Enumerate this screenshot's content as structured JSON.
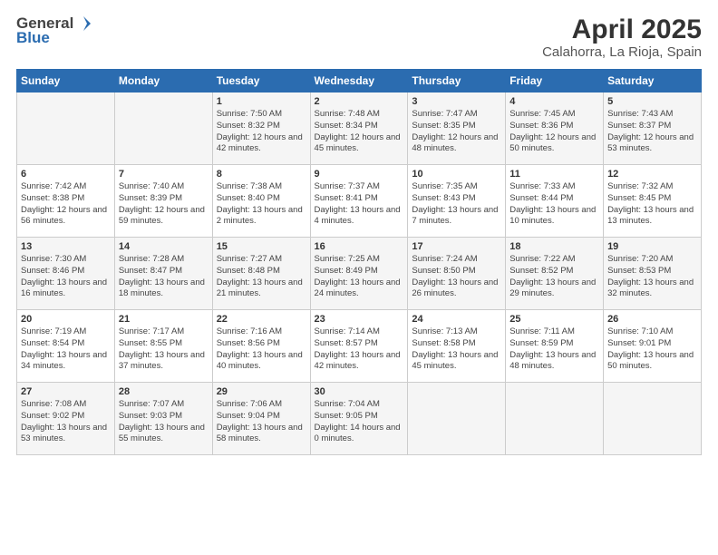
{
  "logo": {
    "general": "General",
    "blue": "Blue"
  },
  "title": "April 2025",
  "subtitle": "Calahorra, La Rioja, Spain",
  "days_of_week": [
    "Sunday",
    "Monday",
    "Tuesday",
    "Wednesday",
    "Thursday",
    "Friday",
    "Saturday"
  ],
  "weeks": [
    [
      {
        "day": "",
        "sunrise": "",
        "sunset": "",
        "daylight": ""
      },
      {
        "day": "",
        "sunrise": "",
        "sunset": "",
        "daylight": ""
      },
      {
        "day": "1",
        "sunrise": "Sunrise: 7:50 AM",
        "sunset": "Sunset: 8:32 PM",
        "daylight": "Daylight: 12 hours and 42 minutes."
      },
      {
        "day": "2",
        "sunrise": "Sunrise: 7:48 AM",
        "sunset": "Sunset: 8:34 PM",
        "daylight": "Daylight: 12 hours and 45 minutes."
      },
      {
        "day": "3",
        "sunrise": "Sunrise: 7:47 AM",
        "sunset": "Sunset: 8:35 PM",
        "daylight": "Daylight: 12 hours and 48 minutes."
      },
      {
        "day": "4",
        "sunrise": "Sunrise: 7:45 AM",
        "sunset": "Sunset: 8:36 PM",
        "daylight": "Daylight: 12 hours and 50 minutes."
      },
      {
        "day": "5",
        "sunrise": "Sunrise: 7:43 AM",
        "sunset": "Sunset: 8:37 PM",
        "daylight": "Daylight: 12 hours and 53 minutes."
      }
    ],
    [
      {
        "day": "6",
        "sunrise": "Sunrise: 7:42 AM",
        "sunset": "Sunset: 8:38 PM",
        "daylight": "Daylight: 12 hours and 56 minutes."
      },
      {
        "day": "7",
        "sunrise": "Sunrise: 7:40 AM",
        "sunset": "Sunset: 8:39 PM",
        "daylight": "Daylight: 12 hours and 59 minutes."
      },
      {
        "day": "8",
        "sunrise": "Sunrise: 7:38 AM",
        "sunset": "Sunset: 8:40 PM",
        "daylight": "Daylight: 13 hours and 2 minutes."
      },
      {
        "day": "9",
        "sunrise": "Sunrise: 7:37 AM",
        "sunset": "Sunset: 8:41 PM",
        "daylight": "Daylight: 13 hours and 4 minutes."
      },
      {
        "day": "10",
        "sunrise": "Sunrise: 7:35 AM",
        "sunset": "Sunset: 8:43 PM",
        "daylight": "Daylight: 13 hours and 7 minutes."
      },
      {
        "day": "11",
        "sunrise": "Sunrise: 7:33 AM",
        "sunset": "Sunset: 8:44 PM",
        "daylight": "Daylight: 13 hours and 10 minutes."
      },
      {
        "day": "12",
        "sunrise": "Sunrise: 7:32 AM",
        "sunset": "Sunset: 8:45 PM",
        "daylight": "Daylight: 13 hours and 13 minutes."
      }
    ],
    [
      {
        "day": "13",
        "sunrise": "Sunrise: 7:30 AM",
        "sunset": "Sunset: 8:46 PM",
        "daylight": "Daylight: 13 hours and 16 minutes."
      },
      {
        "day": "14",
        "sunrise": "Sunrise: 7:28 AM",
        "sunset": "Sunset: 8:47 PM",
        "daylight": "Daylight: 13 hours and 18 minutes."
      },
      {
        "day": "15",
        "sunrise": "Sunrise: 7:27 AM",
        "sunset": "Sunset: 8:48 PM",
        "daylight": "Daylight: 13 hours and 21 minutes."
      },
      {
        "day": "16",
        "sunrise": "Sunrise: 7:25 AM",
        "sunset": "Sunset: 8:49 PM",
        "daylight": "Daylight: 13 hours and 24 minutes."
      },
      {
        "day": "17",
        "sunrise": "Sunrise: 7:24 AM",
        "sunset": "Sunset: 8:50 PM",
        "daylight": "Daylight: 13 hours and 26 minutes."
      },
      {
        "day": "18",
        "sunrise": "Sunrise: 7:22 AM",
        "sunset": "Sunset: 8:52 PM",
        "daylight": "Daylight: 13 hours and 29 minutes."
      },
      {
        "day": "19",
        "sunrise": "Sunrise: 7:20 AM",
        "sunset": "Sunset: 8:53 PM",
        "daylight": "Daylight: 13 hours and 32 minutes."
      }
    ],
    [
      {
        "day": "20",
        "sunrise": "Sunrise: 7:19 AM",
        "sunset": "Sunset: 8:54 PM",
        "daylight": "Daylight: 13 hours and 34 minutes."
      },
      {
        "day": "21",
        "sunrise": "Sunrise: 7:17 AM",
        "sunset": "Sunset: 8:55 PM",
        "daylight": "Daylight: 13 hours and 37 minutes."
      },
      {
        "day": "22",
        "sunrise": "Sunrise: 7:16 AM",
        "sunset": "Sunset: 8:56 PM",
        "daylight": "Daylight: 13 hours and 40 minutes."
      },
      {
        "day": "23",
        "sunrise": "Sunrise: 7:14 AM",
        "sunset": "Sunset: 8:57 PM",
        "daylight": "Daylight: 13 hours and 42 minutes."
      },
      {
        "day": "24",
        "sunrise": "Sunrise: 7:13 AM",
        "sunset": "Sunset: 8:58 PM",
        "daylight": "Daylight: 13 hours and 45 minutes."
      },
      {
        "day": "25",
        "sunrise": "Sunrise: 7:11 AM",
        "sunset": "Sunset: 8:59 PM",
        "daylight": "Daylight: 13 hours and 48 minutes."
      },
      {
        "day": "26",
        "sunrise": "Sunrise: 7:10 AM",
        "sunset": "Sunset: 9:01 PM",
        "daylight": "Daylight: 13 hours and 50 minutes."
      }
    ],
    [
      {
        "day": "27",
        "sunrise": "Sunrise: 7:08 AM",
        "sunset": "Sunset: 9:02 PM",
        "daylight": "Daylight: 13 hours and 53 minutes."
      },
      {
        "day": "28",
        "sunrise": "Sunrise: 7:07 AM",
        "sunset": "Sunset: 9:03 PM",
        "daylight": "Daylight: 13 hours and 55 minutes."
      },
      {
        "day": "29",
        "sunrise": "Sunrise: 7:06 AM",
        "sunset": "Sunset: 9:04 PM",
        "daylight": "Daylight: 13 hours and 58 minutes."
      },
      {
        "day": "30",
        "sunrise": "Sunrise: 7:04 AM",
        "sunset": "Sunset: 9:05 PM",
        "daylight": "Daylight: 14 hours and 0 minutes."
      },
      {
        "day": "",
        "sunrise": "",
        "sunset": "",
        "daylight": ""
      },
      {
        "day": "",
        "sunrise": "",
        "sunset": "",
        "daylight": ""
      },
      {
        "day": "",
        "sunrise": "",
        "sunset": "",
        "daylight": ""
      }
    ]
  ]
}
